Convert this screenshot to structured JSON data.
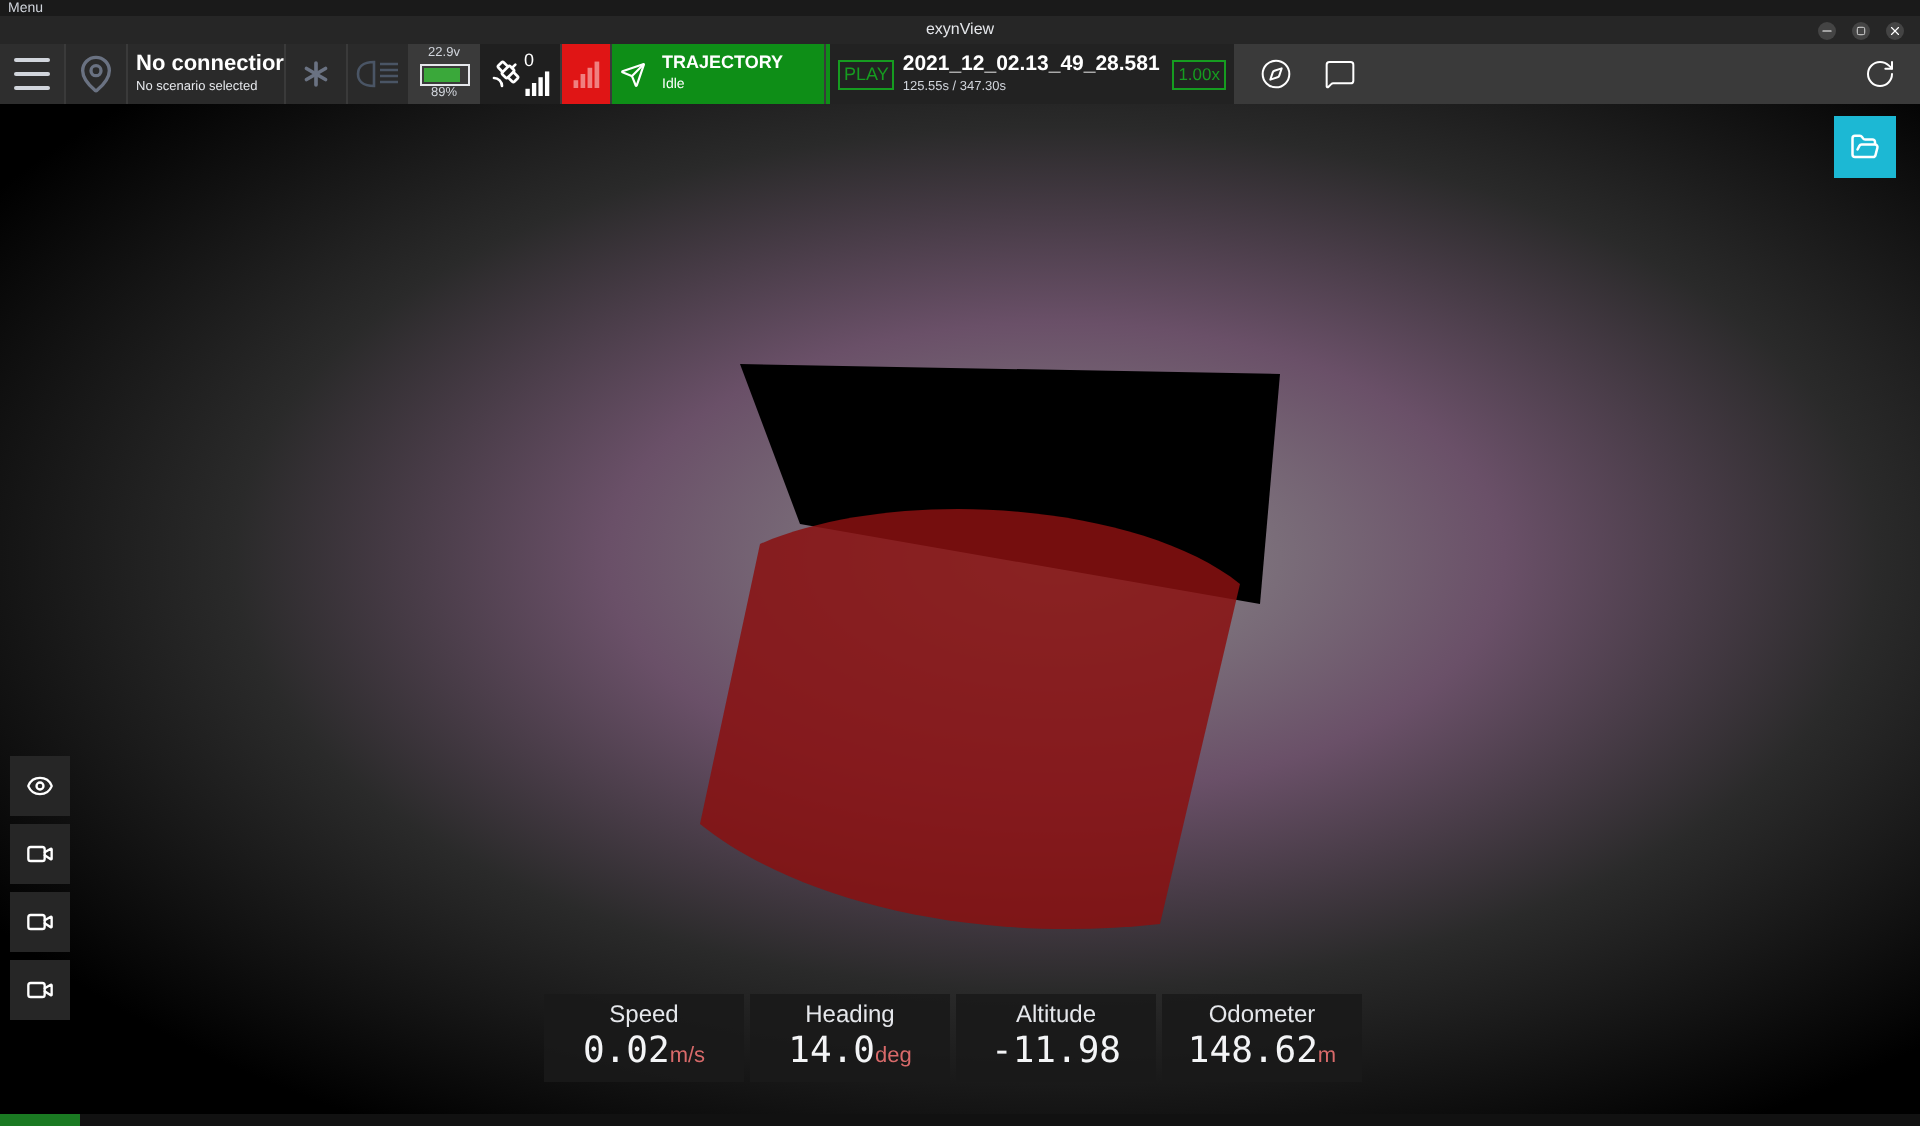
{
  "menu_bar": {
    "label": "Menu"
  },
  "window": {
    "title": "exynView"
  },
  "toolbar": {
    "connection": {
      "title": "No connectior",
      "subtitle": "No scenario selected"
    },
    "battery": {
      "voltage": "22.9v",
      "level": 0.89,
      "percent": "89%"
    },
    "satellites": {
      "count": "0"
    },
    "trajectory": {
      "title": "TRAJECTORY",
      "status": "Idle"
    },
    "playback": {
      "button": "PLAY",
      "file": "2021_12_02.13_49_28.581",
      "time": "125.55s / 347.30s",
      "speed": "1.00x"
    }
  },
  "stats": [
    {
      "label": "Speed",
      "value": "0.02",
      "unit": "m/s"
    },
    {
      "label": "Heading",
      "value": "14.0",
      "unit": "deg"
    },
    {
      "label": "Altitude",
      "value": "-11.98"
    },
    {
      "label": "Odometer",
      "value": "148.62",
      "unit": "m"
    }
  ]
}
